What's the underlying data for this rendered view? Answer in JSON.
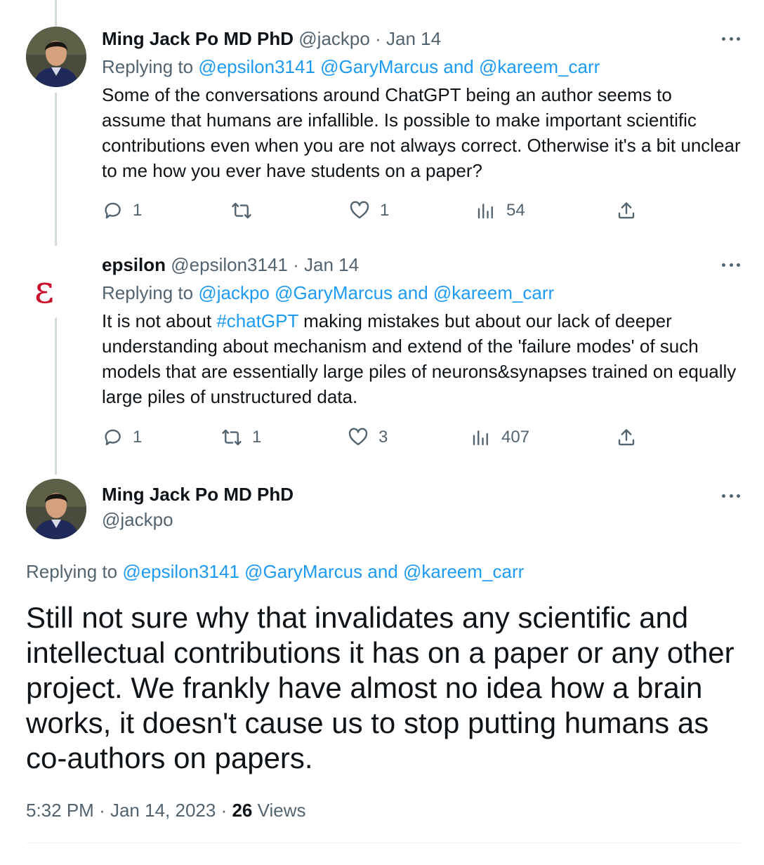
{
  "tweets": [
    {
      "author_name": "Ming Jack Po MD PhD",
      "handle": "@jackpo",
      "separator": "·",
      "date": "Jan 14",
      "replying_prefix": "Replying to",
      "replying_mentions": "@epsilon3141 @GaryMarcus and @kareem_carr",
      "text": "Some of the conversations around ChatGPT being an author seems to assume that humans are infallible. Is possible to make important scientific contributions even when you are not always correct. Otherwise it's a bit unclear to me how you ever have students on a paper?",
      "replies": "1",
      "retweets": "",
      "likes": "1",
      "views": "54"
    },
    {
      "author_name": "epsilon",
      "handle": "@epsilon3141",
      "separator": "·",
      "date": "Jan 14",
      "avatar_glyph": "ε",
      "replying_prefix": "Replying to",
      "replying_mentions": "@jackpo @GaryMarcus and @kareem_carr",
      "text_before": "It is not about ",
      "hashtag": "#chatGPT",
      "text_after": " making mistakes but about our lack of deeper understanding about mechanism and extend of the 'failure modes' of such models that are essentially large piles of neurons&synapses trained on equally large piles of unstructured data.",
      "replies": "1",
      "retweets": "1",
      "likes": "3",
      "views": "407"
    }
  ],
  "main_tweet": {
    "author_name": "Ming Jack Po MD PhD",
    "handle": "@jackpo",
    "replying_prefix": "Replying to",
    "replying_mentions": "@epsilon3141 @GaryMarcus and @kareem_carr",
    "text": "Still not sure why that invalidates any scientific and intellectual contributions it has on a paper or any other project. We frankly have almost no idea how a brain works, it doesn't cause us to stop putting humans as co-authors on papers.",
    "time": "5:32 PM",
    "separator": "·",
    "date": "Jan 14, 2023",
    "views_count": "26",
    "views_label": "Views"
  },
  "colors": {
    "link": "#1d9bf0",
    "muted": "#536471",
    "text": "#0f1419",
    "thread_line": "#cfd9de",
    "epsilon_red": "#c8102e"
  },
  "icons": [
    "reply-icon",
    "retweet-icon",
    "like-icon",
    "views-icon",
    "share-icon",
    "more-icon"
  ]
}
